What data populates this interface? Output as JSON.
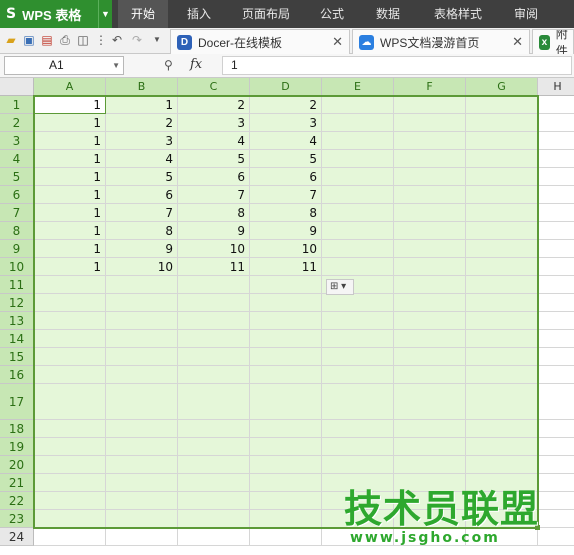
{
  "menubar": {
    "app_name": "WPS 表格",
    "tabs": [
      "开始",
      "插入",
      "页面布局",
      "公式",
      "数据",
      "表格样式",
      "审阅"
    ]
  },
  "toolbar": {
    "doc_tabs": [
      {
        "title": "Docer-在线模板",
        "icon": "D"
      },
      {
        "title": "WPS文档漫游首页",
        "icon": "☁"
      },
      {
        "title": "附件",
        "icon": "x"
      }
    ]
  },
  "formula_bar": {
    "name_box": "A1",
    "fx_label": "fx",
    "formula": "1"
  },
  "grid": {
    "columns": [
      "A",
      "B",
      "C",
      "D",
      "E",
      "F",
      "G",
      "H"
    ],
    "rows": [
      "1",
      "2",
      "3",
      "4",
      "5",
      "6",
      "7",
      "8",
      "9",
      "10",
      "11",
      "12",
      "13",
      "14",
      "15",
      "16",
      "17",
      "18",
      "19",
      "20",
      "21",
      "22",
      "23",
      "24"
    ],
    "data": [
      [
        "1",
        "1",
        "2",
        "2"
      ],
      [
        "1",
        "2",
        "3",
        "3"
      ],
      [
        "1",
        "3",
        "4",
        "4"
      ],
      [
        "1",
        "4",
        "5",
        "5"
      ],
      [
        "1",
        "5",
        "6",
        "6"
      ],
      [
        "1",
        "6",
        "7",
        "7"
      ],
      [
        "1",
        "7",
        "8",
        "8"
      ],
      [
        "1",
        "8",
        "9",
        "9"
      ],
      [
        "1",
        "9",
        "10",
        "10"
      ],
      [
        "1",
        "10",
        "11",
        "11"
      ]
    ]
  },
  "watermark": {
    "title": "技术员联盟",
    "url": "www.jsgho.com"
  },
  "colors": {
    "accent": "#5c9a37",
    "selection_fill": "#e5f7d9",
    "menu_bg": "#3f3f3f",
    "app_button": "#2f8f2f"
  }
}
